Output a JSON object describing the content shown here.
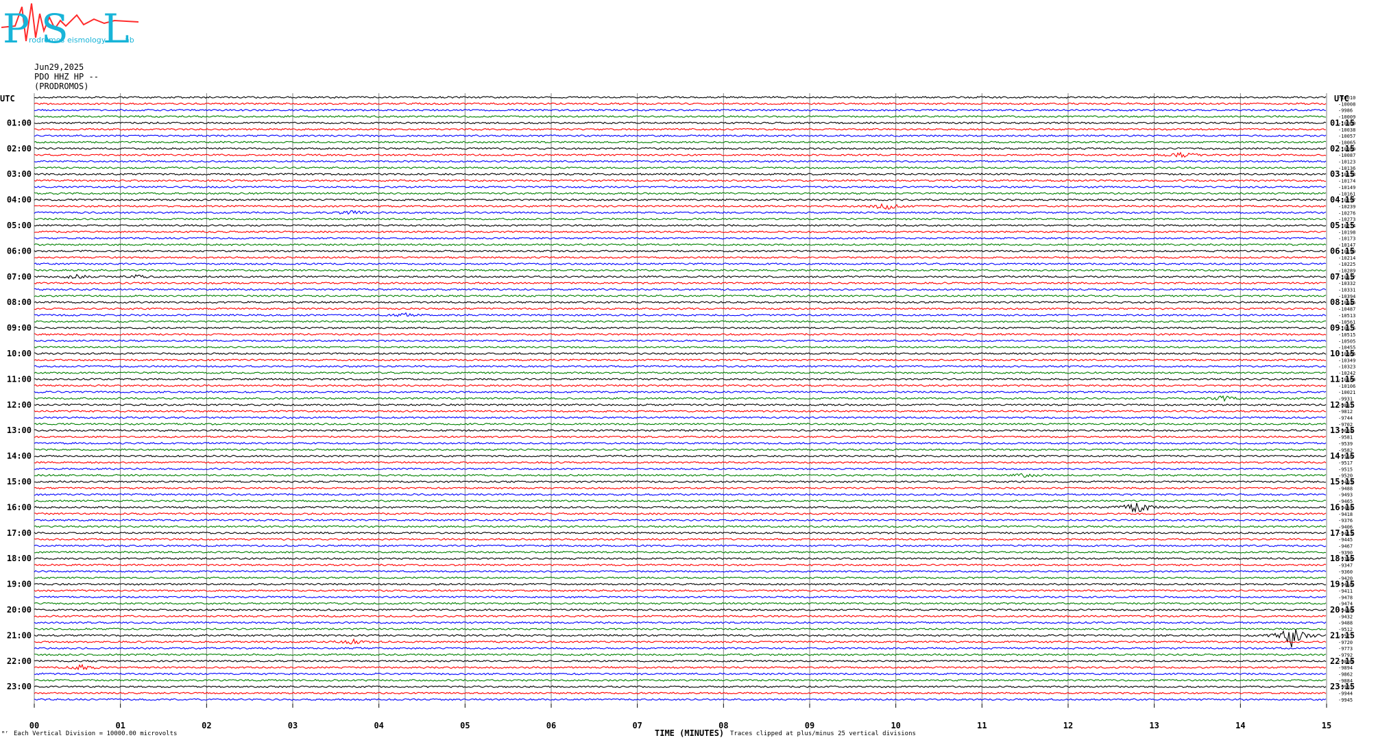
{
  "logo": {
    "text": "PSL",
    "subtitle_parts": [
      "Prodromos",
      "Seismology",
      "Lab"
    ],
    "colors": {
      "letters": "#18b4d8",
      "trace": "#ff2a2a"
    }
  },
  "header": {
    "date": "Jun29,2025",
    "station": "PDO HHZ HP --",
    "location": "(PRODROMOS)"
  },
  "axis_corner_left": "UTC",
  "axis_corner_right": "UTC",
  "footer": {
    "scale_note": "Each Vertical Division = 10000.00 microvolts",
    "x_title": "TIME (MINUTES)",
    "clip_note": "Traces clipped at plus/minus 25 vertical divisions",
    "corner_mark": "ᵐʳ"
  },
  "chart_data": {
    "type": "line",
    "title": "",
    "xlabel": "TIME (MINUTES)",
    "ylabel": "",
    "xlim": [
      0,
      15
    ],
    "x_ticks": [
      "00",
      "01",
      "02",
      "03",
      "04",
      "05",
      "06",
      "07",
      "08",
      "09",
      "10",
      "11",
      "12",
      "13",
      "14",
      "15"
    ],
    "grid": "vertical lines at each minute",
    "trace_colors": [
      "#000000",
      "#ff0000",
      "#0000ff",
      "#008000"
    ],
    "row_minutes": 15,
    "left_hour_labels": [
      "01:00",
      "02:00",
      "03:00",
      "04:00",
      "05:00",
      "06:00",
      "07:00",
      "08:00",
      "09:00",
      "10:00",
      "11:00",
      "12:00",
      "13:00",
      "14:00",
      "15:00",
      "16:00",
      "17:00",
      "18:00",
      "19:00",
      "20:00",
      "21:00",
      "22:00",
      "23:00"
    ],
    "right_hour_labels": [
      "01:15",
      "02:15",
      "03:15",
      "04:15",
      "05:15",
      "06:15",
      "07:15",
      "08:15",
      "09:15",
      "10:15",
      "11:15",
      "12:15",
      "13:15",
      "14:15",
      "15:15",
      "16:15",
      "17:15",
      "18:15",
      "19:15",
      "20:15",
      "21:15",
      "22:15",
      "23:15"
    ],
    "row_offsets": [
      -10010,
      -10008,
      -9986,
      -10009,
      -10000,
      -10038,
      -10057,
      -10065,
      -10080,
      -10087,
      -10123,
      -10136,
      -10153,
      -10174,
      -10149,
      -10161,
      -10197,
      -10239,
      -10276,
      -10273,
      -10274,
      -10198,
      -10173,
      -10147,
      -10199,
      -10214,
      -10225,
      -10289,
      -10317,
      -10332,
      -10331,
      -10394,
      -10446,
      -10487,
      -10513,
      -10561,
      -10575,
      -10515,
      -10505,
      -10455,
      -10366,
      -10349,
      -10323,
      -10242,
      -10164,
      -10106,
      -10021,
      -9931,
      -9881,
      -9812,
      -9744,
      -9702,
      -9634,
      -9581,
      -9539,
      -9582,
      -9558,
      -9517,
      -9515,
      -9520,
      -9493,
      -9488,
      -9493,
      -9465,
      -9484,
      -9418,
      -9376,
      -9406,
      -9413,
      -9445,
      -9467,
      -9390,
      -9348,
      -9347,
      -9360,
      -9420,
      -9458,
      -9411,
      -9478,
      -9474,
      -9440,
      -9432,
      -9488,
      -9512,
      -9577,
      -9720,
      -9773,
      -9792,
      -9890,
      -9894,
      -9862,
      -9884,
      -9907,
      -9944,
      -9945
    ],
    "events": [
      {
        "row": 9,
        "minute": 13.3,
        "amplitude": 2.0,
        "color": "red"
      },
      {
        "row": 17,
        "minute": 9.9,
        "amplitude": 3.0,
        "color": "red"
      },
      {
        "row": 18,
        "minute": 3.7,
        "amplitude": 1.5,
        "color": "blue"
      },
      {
        "row": 28,
        "minute": 0.5,
        "amplitude": 1.5,
        "color": "black"
      },
      {
        "row": 28,
        "minute": 1.2,
        "amplitude": 1.2,
        "color": "black"
      },
      {
        "row": 34,
        "minute": 4.3,
        "amplitude": 1.2,
        "color": "blue"
      },
      {
        "row": 47,
        "minute": 13.8,
        "amplitude": 2.0,
        "color": "green"
      },
      {
        "row": 59,
        "minute": 11.5,
        "amplitude": 1.5,
        "color": "green"
      },
      {
        "row": 64,
        "minute": 12.8,
        "amplitude": 5.0,
        "color": "black"
      },
      {
        "row": 84,
        "minute": 14.6,
        "amplitude": 9.0,
        "color": "black"
      },
      {
        "row": 85,
        "minute": 3.7,
        "amplitude": 1.8,
        "color": "red"
      },
      {
        "row": 89,
        "minute": 0.55,
        "amplitude": 2.0,
        "color": "red"
      }
    ]
  }
}
